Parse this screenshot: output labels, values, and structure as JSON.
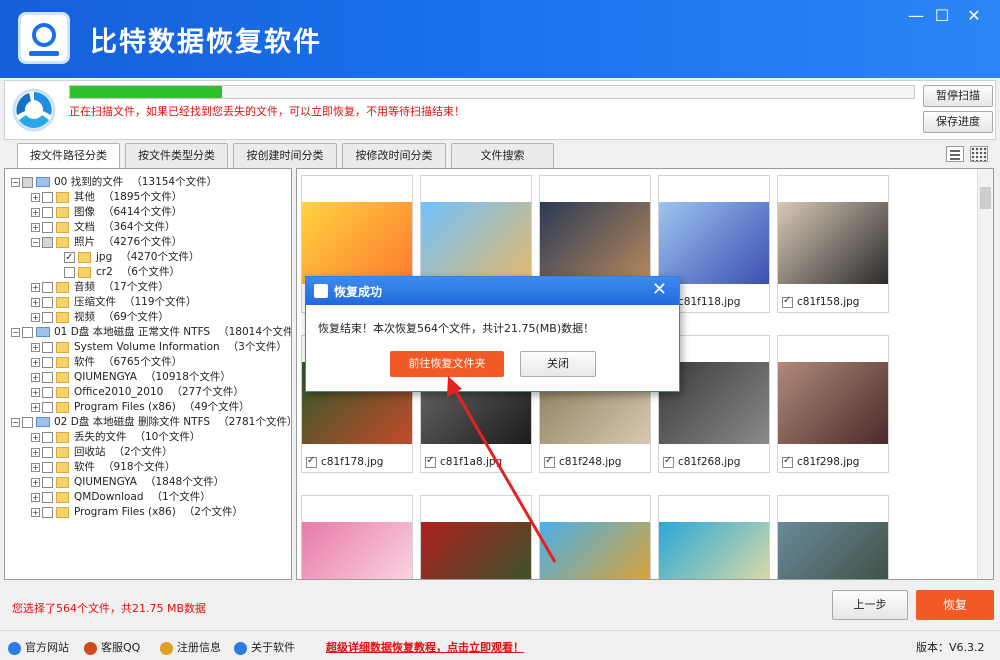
{
  "app": {
    "title": "比特数据恢复软件"
  },
  "window": {
    "minimize": "—",
    "maximize": "☐",
    "close": "✕"
  },
  "scan": {
    "progress": 0.18,
    "message": "正在扫描文件，如果已经找到您丢失的文件，可以立即恢复，不用等待扫描结束！",
    "pause_label": "暂停扫描",
    "save_label": "保存进度"
  },
  "tabs": [
    "按文件路径分类",
    "按文件类型分类",
    "按创建时间分类",
    "按修改时间分类",
    "文件搜索"
  ],
  "tree": [
    {
      "label": "00 找到的文件",
      "count": "（13154个文件）",
      "type": "drive",
      "check": "part",
      "exp": "−",
      "level": 0
    },
    {
      "label": "其他",
      "count": "（1895个文件）",
      "type": "folder",
      "check": "off",
      "exp": "+",
      "level": 1
    },
    {
      "label": "图像",
      "count": "（6414个文件）",
      "type": "folder",
      "check": "off",
      "exp": "+",
      "level": 1
    },
    {
      "label": "文档",
      "count": "（364个文件）",
      "type": "folder",
      "check": "off",
      "exp": "+",
      "level": 1
    },
    {
      "label": "照片",
      "count": "（4276个文件）",
      "type": "folder",
      "check": "part",
      "exp": "−",
      "level": 1
    },
    {
      "label": "jpg",
      "count": "（4270个文件）",
      "type": "folder",
      "check": "on",
      "exp": "",
      "level": 2
    },
    {
      "label": "cr2",
      "count": "（6个文件）",
      "type": "folder",
      "check": "off",
      "exp": "",
      "level": 2
    },
    {
      "label": "音频",
      "count": "（17个文件）",
      "type": "folder",
      "check": "off",
      "exp": "+",
      "level": 1
    },
    {
      "label": "压缩文件",
      "count": "（119个文件）",
      "type": "folder",
      "check": "off",
      "exp": "+",
      "level": 1
    },
    {
      "label": "视频",
      "count": "（69个文件）",
      "type": "folder",
      "check": "off",
      "exp": "+",
      "level": 1
    },
    {
      "label": "01 D盘 本地磁盘 正常文件 NTFS",
      "count": "（18014个文件",
      "type": "drive",
      "check": "off",
      "exp": "−",
      "level": 0
    },
    {
      "label": "System Volume Information",
      "count": "（3个文件）",
      "type": "folder",
      "check": "off",
      "exp": "+",
      "level": 1
    },
    {
      "label": "软件",
      "count": "（6765个文件）",
      "type": "folder",
      "check": "off",
      "exp": "+",
      "level": 1
    },
    {
      "label": "QIUMENGYA",
      "count": "（10918个文件）",
      "type": "folder",
      "check": "off",
      "exp": "+",
      "level": 1
    },
    {
      "label": "Office2010_2010",
      "count": "（277个文件）",
      "type": "folder",
      "check": "off",
      "exp": "+",
      "level": 1
    },
    {
      "label": "Program Files (x86)",
      "count": "（49个文件）",
      "type": "folder",
      "check": "off",
      "exp": "+",
      "level": 1
    },
    {
      "label": "02 D盘 本地磁盘 删除文件 NTFS",
      "count": "（2781个文件）",
      "type": "drive",
      "check": "off",
      "exp": "−",
      "level": 0
    },
    {
      "label": "丢失的文件",
      "count": "（10个文件）",
      "type": "folder",
      "check": "off",
      "exp": "+",
      "level": 1
    },
    {
      "label": "回收站",
      "count": "（2个文件）",
      "type": "folder",
      "check": "off",
      "exp": "+",
      "level": 1
    },
    {
      "label": "软件",
      "count": "（918个文件）",
      "type": "folder",
      "check": "off",
      "exp": "+",
      "level": 1
    },
    {
      "label": "QIUMENGYA",
      "count": "（1848个文件）",
      "type": "folder",
      "check": "off",
      "exp": "+",
      "level": 1
    },
    {
      "label": "QMDownload",
      "count": "（1个文件）",
      "type": "folder",
      "check": "off",
      "exp": "+",
      "level": 1
    },
    {
      "label": "Program Files (x86)",
      "count": "（2个文件）",
      "type": "folder",
      "check": "off",
      "exp": "+",
      "level": 1
    }
  ],
  "thumbnails": [
    {
      "name": "",
      "colors": [
        "#ffd23f",
        "#ff7a2f"
      ]
    },
    {
      "name": "",
      "colors": [
        "#6fc3ff",
        "#e8b86b"
      ]
    },
    {
      "name": "",
      "colors": [
        "#2a3a55",
        "#b88a5c"
      ]
    },
    {
      "name": "c81f118.jpg",
      "colors": [
        "#9ec4f0",
        "#3a4fb0"
      ]
    },
    {
      "name": "c81f158.jpg",
      "colors": [
        "#d8c9b8",
        "#2b2b2b"
      ]
    },
    {
      "name": "c81f178.jpg",
      "colors": [
        "#2f5a2a",
        "#c24a2a"
      ]
    },
    {
      "name": "c81f1a8.jpg",
      "colors": [
        "#6a6a6a",
        "#1c1c1c"
      ]
    },
    {
      "name": "c81f248.jpg",
      "colors": [
        "#8a7a5a",
        "#d8c8b0"
      ]
    },
    {
      "name": "c81f268.jpg",
      "colors": [
        "#3a3a3a",
        "#8a8a8a"
      ]
    },
    {
      "name": "c81f298.jpg",
      "colors": [
        "#b08a7a",
        "#4a2a2a"
      ]
    },
    {
      "name": "",
      "colors": [
        "#e87aa8",
        "#fbe0ea"
      ]
    },
    {
      "name": "",
      "colors": [
        "#b02020",
        "#2a5a2a"
      ]
    },
    {
      "name": "",
      "colors": [
        "#4ab0e8",
        "#f0a020"
      ]
    },
    {
      "name": "",
      "colors": [
        "#2aa8d8",
        "#f0e0a0"
      ]
    },
    {
      "name": "",
      "colors": [
        "#6a8a9a",
        "#3a4a3a"
      ]
    }
  ],
  "dialog": {
    "title": "恢复成功",
    "message": "恢复结束！本次恢复564个文件，共计21.75(MB)数据！",
    "primary_label": "前往恢复文件夹",
    "close_label": "关闭"
  },
  "status": {
    "selection": "您选择了564个文件，共21.75 MB数据"
  },
  "buttons": {
    "prev": "上一步",
    "recover": "恢复"
  },
  "footer": {
    "links": [
      {
        "label": "官方网站",
        "icon": "globe-icon",
        "color": "#2b7de0"
      },
      {
        "label": "客服QQ",
        "icon": "qq-penguin-icon",
        "color": "#cc4b1c"
      },
      {
        "label": "注册信息",
        "icon": "key-icon",
        "color": "#e0a020"
      },
      {
        "label": "关于软件",
        "icon": "info-globe-icon",
        "color": "#2b7de0"
      }
    ],
    "promo": "超级详细数据恢复教程，点击立即观看！",
    "version": "版本：V6.3.2"
  },
  "colors": {
    "accent": "#1a72ee",
    "orange": "#f15a24",
    "warn": "#e01010",
    "progress": "#2ec22e"
  }
}
